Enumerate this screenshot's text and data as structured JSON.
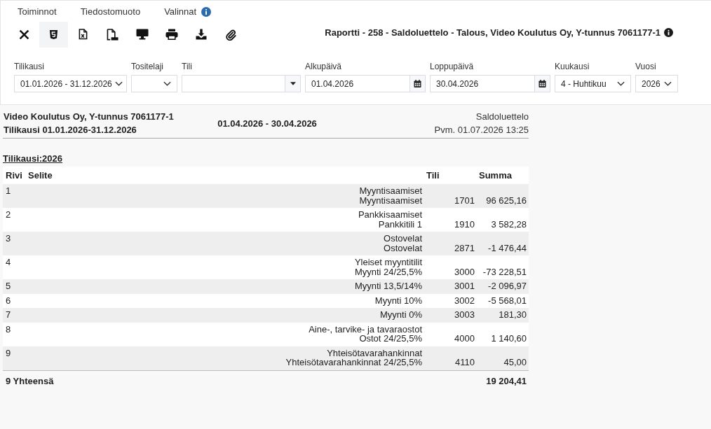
{
  "menu": [
    {
      "label": "Toiminnot",
      "info": false
    },
    {
      "label": "Tiedostomuoto",
      "info": false
    },
    {
      "label": "Valinnat",
      "info": true
    }
  ],
  "toolbar": {
    "buttons": [
      {
        "kind": "close",
        "selected": false
      },
      {
        "kind": "html",
        "selected": true
      },
      {
        "kind": "excel",
        "selected": false
      },
      {
        "kind": "pdf",
        "selected": false
      },
      {
        "kind": "screen",
        "selected": false
      },
      {
        "kind": "print",
        "selected": false
      },
      {
        "kind": "download",
        "selected": false
      },
      {
        "kind": "attach",
        "selected": false
      }
    ],
    "title": "Raportti - 258 - Saldoluettelo - Talous, Video Koulutus Oy, Y-tunnus 7061177-1"
  },
  "filters": [
    {
      "kind": "select",
      "label": "Tilikausi",
      "value": "01.01.2026 - 31.12.2026"
    },
    {
      "kind": "select",
      "label": "Tositelaji"
    },
    {
      "kind": "combo",
      "label": "Tili"
    },
    {
      "kind": "date",
      "label": "Alkupäivä",
      "value": "01.04.2026"
    },
    {
      "kind": "date",
      "label": "Loppupäivä",
      "value": "30.04.2026"
    },
    {
      "kind": "select",
      "label": "Kuukausi",
      "value": "4 - Huhtikuu"
    },
    {
      "kind": "select",
      "label": "Vuosi",
      "value": "2026"
    }
  ],
  "report": {
    "company": "Video Koulutus Oy, Y-tunnus 7061177-1",
    "fiscal_period": "Tilikausi 01.01.2026-31.12.2026",
    "date_range": "01.04.2026 - 30.04.2026",
    "report_name": "Saldoluettelo",
    "printed": "Pvm. 01.07.2026 13:25",
    "section_title": "Tilikausi:2026"
  },
  "table": {
    "columns": [
      "Rivi",
      "Selite",
      "Tili",
      "Summa"
    ],
    "rows": [
      {
        "row": "1",
        "group": "Myyntisaamiset",
        "description": "Myyntisaamiset",
        "account": "1701",
        "amount": "96 625,16"
      },
      {
        "row": "2",
        "group": "Pankkisaamiset",
        "description": "Pankkitili 1",
        "account": "1910",
        "amount": "3 582,28"
      },
      {
        "row": "3",
        "group": "Ostovelat",
        "description": "Ostovelat",
        "account": "2871",
        "amount": "-1 476,44"
      },
      {
        "row": "4",
        "group": "Yleiset myyntitilit",
        "description": "Myynti 24/25,5%",
        "account": "3000",
        "amount": "-73 228,51"
      },
      {
        "row": "5",
        "description": "Myynti 13,5/14%",
        "account": "3001",
        "amount": "-2 096,97"
      },
      {
        "row": "6",
        "description": "Myynti 10%",
        "account": "3002",
        "amount": "-5 568,01"
      },
      {
        "row": "7",
        "description": "Myynti 0%",
        "account": "3003",
        "amount": "181,30"
      },
      {
        "row": "8",
        "group": "Aine-, tarvike- ja tavaraostot",
        "description": "Ostot 24/25,5%",
        "account": "4000",
        "amount": "1 140,60"
      },
      {
        "row": "9",
        "group": "Yhteisötavarahankinnat",
        "description": "Yhteisötavarahankinnat 24/25,5%",
        "account": "4110",
        "amount": "45,00"
      }
    ],
    "total": {
      "label": "9 Yhteensä",
      "amount": "19 204,41"
    }
  }
}
